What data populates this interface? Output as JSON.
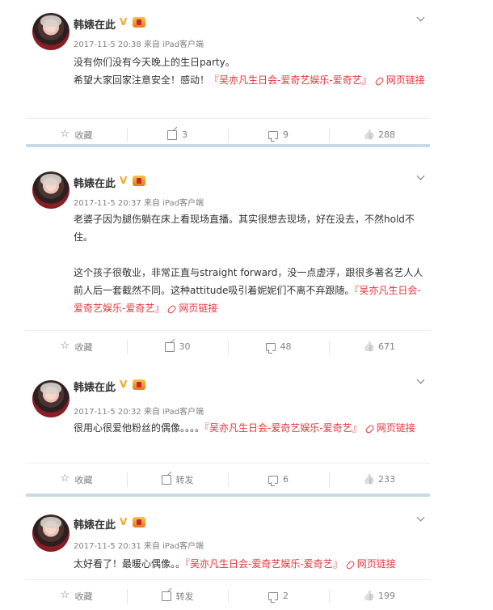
{
  "posts": [
    {
      "author": "韩婊在此",
      "meta": "2017-11-5 20:38 来自 iPad客户端",
      "paragraphs": [
        [
          {
            "t": "没有你们没有今天晚上的生日party。"
          }
        ],
        [
          {
            "t": "希望大家回家注意安全！感动！"
          },
          {
            "t": "『吴亦凡生日会-爱奇艺娱乐-爱奇艺』",
            "tag": true
          },
          {
            "t": "网页链接",
            "link": true
          }
        ]
      ],
      "actions": [
        "收藏",
        "3",
        "9",
        "288"
      ]
    },
    {
      "author": "韩婊在此",
      "meta": "2017-11-5 20:37 来自 iPad客户端",
      "paragraphs": [
        [
          {
            "t": "老婆子因为腿伤躺在床上看现场直播。其实很想去现场，好在没去，不然hold不住。"
          }
        ],
        [],
        [
          {
            "t": "这个孩子很敬业，非常正直与straight forward，没一点虚浮，跟很多著名艺人人前人后一套截然不同。这种attitude吸引着妮妮们不离不弃跟随。"
          },
          {
            "t": "『吴亦凡生日会-爱奇艺娱乐-爱奇艺』",
            "tag": true
          },
          {
            "t": "网页链接",
            "link": true
          }
        ]
      ],
      "actions": [
        "收藏",
        "30",
        "48",
        "671"
      ]
    },
    {
      "author": "韩婊在此",
      "meta": "2017-11-5 20:32 来自 iPad客户端",
      "paragraphs": [
        [
          {
            "t": "很用心很爱他粉丝的偶像。。。。"
          },
          {
            "t": "『吴亦凡生日会-爱奇艺娱乐-爱奇艺』",
            "tag": true
          },
          {
            "t": "网页链接",
            "link": true
          }
        ]
      ],
      "actions": [
        "收藏",
        "转发",
        "6",
        "233"
      ]
    },
    {
      "author": "韩婊在此",
      "meta": "2017-11-5 20:31 来自 iPad客户端",
      "paragraphs": [
        [
          {
            "t": "太好看了！最暖心偶像。。"
          },
          {
            "t": "『吴亦凡生日会-爱奇艺娱乐-爱奇艺』",
            "tag": true
          },
          {
            "t": "网页链接",
            "link": true
          }
        ]
      ],
      "actions": [
        "收藏",
        "转发",
        "2",
        "199"
      ]
    }
  ],
  "icons": {
    "verified": "verified-v-icon",
    "level": "vip-level-icon",
    "more": "chevron-down-icon",
    "link": "link-icon",
    "actions": [
      "star-icon",
      "share-icon",
      "comment-icon",
      "like-icon"
    ]
  },
  "colors": {
    "accent_link": "#e83338",
    "divider": "#c6dbe6",
    "verified": "#f6a623"
  }
}
